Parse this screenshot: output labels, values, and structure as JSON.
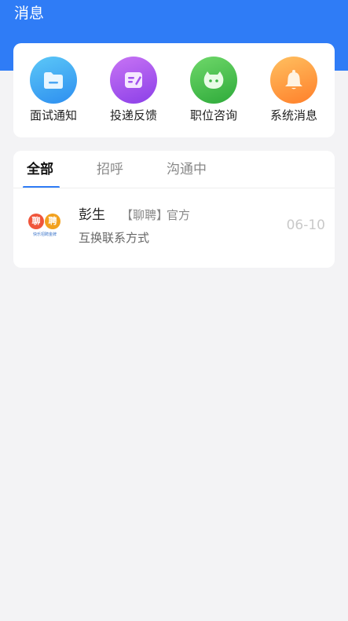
{
  "header": {
    "title": "消息",
    "background": "#2f7cf6"
  },
  "shortcuts": [
    {
      "label": "面试通知",
      "icon": "folder-icon"
    },
    {
      "label": "投递反馈",
      "icon": "edit-note-icon"
    },
    {
      "label": "职位咨询",
      "icon": "chat-face-icon"
    },
    {
      "label": "系统消息",
      "icon": "bell-icon"
    }
  ],
  "tabs": [
    {
      "label": "全部",
      "active": true
    },
    {
      "label": "招呼",
      "active": false
    },
    {
      "label": "沟通中",
      "active": false
    }
  ],
  "conversations": [
    {
      "name": "彭生",
      "tag": "【聊聘】",
      "official": "官方",
      "time": "06-10",
      "preview": "互换联系方式",
      "avatar": {
        "char1": "聊",
        "char2": "聘",
        "caption": "快乐招聘金牌"
      }
    }
  ]
}
